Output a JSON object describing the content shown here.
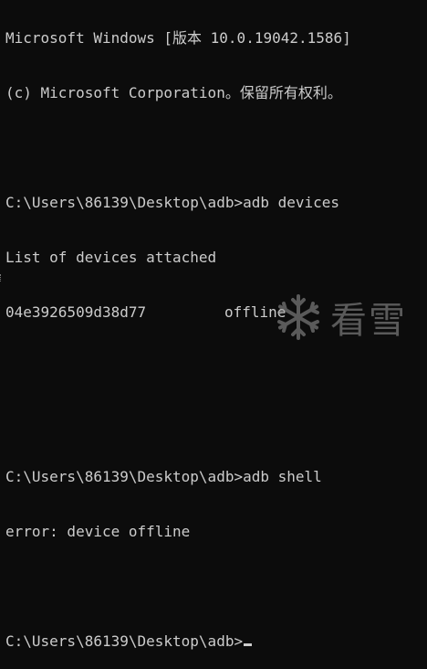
{
  "terminal": {
    "lines": {
      "header1": "Microsoft Windows [版本 10.0.19042.1586]",
      "header2": "(c) Microsoft Corporation。保留所有权利。",
      "cmd1": "C:\\Users\\86139\\Desktop\\adb>adb devices",
      "list_header": "List of devices attached",
      "device_serial": "04e3926509d38d77",
      "device_state": "offline",
      "cmd2": "C:\\Users\\86139\\Desktop\\adb>adb shell",
      "error": "error: device offline",
      "prompt": "C:\\Users\\86139\\Desktop\\adb>"
    }
  },
  "watermark": {
    "text": "看雪",
    "icon": "snowflake-icon"
  },
  "colors": {
    "background": "#0c0c0c",
    "foreground": "#cccccc"
  }
}
